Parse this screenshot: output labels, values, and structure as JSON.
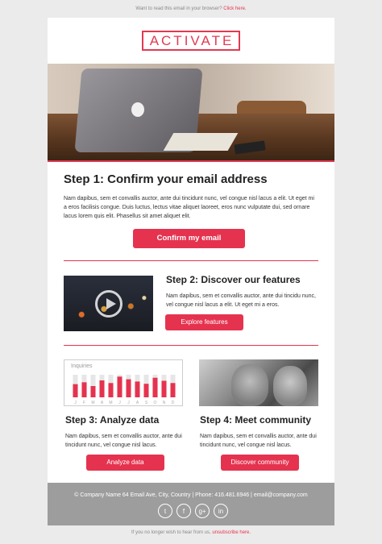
{
  "topbar": {
    "text": "Want to read this email in your browser?",
    "link": "Click here."
  },
  "logo": "ACTIVATE",
  "step1": {
    "title": "Step 1: Confirm your email address",
    "body": "Nam dapibus, sem et convallis auctor, ante dui tincidunt nunc, vel congue nisl lacus a elit. Ut eget mi a eros facilisis congue. Duis luctus, lectus vitae aliquet laoreet, eros nunc vulputate dui, sed ornare lacus lorem quis elit. Phasellus sit amet aliquet elit.",
    "button": "Confirm my email"
  },
  "step2": {
    "title": "Step 2: Discover our features",
    "body": "Nam dapibus, sem et convallis auctor, ante dui tincidu nunc, vel congue nisl lacus a elit. Ut eget mi a eros.",
    "button": "Explore features"
  },
  "step3": {
    "title": "Step 3: Analyze data",
    "body": "Nam dapibus, sem et convallis auctor, ante dui tincidunt nunc, vel congue nisl lacus.",
    "button": "Analyze data"
  },
  "step4": {
    "title": "Step 4: Meet community",
    "body": "Nam dapibus, sem et convallis auctor, ante dui tincidunt nunc, vel congue nisl lacus.",
    "button": "Discover community"
  },
  "chart_data": {
    "type": "bar",
    "title": "Inquiries",
    "categories": [
      "J",
      "F",
      "M",
      "A",
      "M",
      "J",
      "J",
      "A",
      "S",
      "O",
      "N",
      "D"
    ],
    "values": [
      35,
      40,
      30,
      45,
      38,
      55,
      48,
      42,
      36,
      52,
      44,
      38
    ],
    "ylim": [
      0,
      60
    ],
    "bar_color": "#e5334f",
    "track_color": "#e6e6e6"
  },
  "footer": {
    "text": "© Company Name 64 Email Ave, City, Country | Phone: 416.481.6946 | email@company.com",
    "socials": [
      {
        "name": "twitter-icon",
        "glyph": "t"
      },
      {
        "name": "facebook-icon",
        "glyph": "f"
      },
      {
        "name": "google-plus-icon",
        "glyph": "g+"
      },
      {
        "name": "linkedin-icon",
        "glyph": "in"
      }
    ]
  },
  "bottom": {
    "text": "If you no longer wish to hear from us,",
    "link": "unsubscribe here."
  },
  "colors": {
    "accent": "#e5334f",
    "footer_bg": "#9d9d9d",
    "page_bg": "#ebebeb"
  }
}
